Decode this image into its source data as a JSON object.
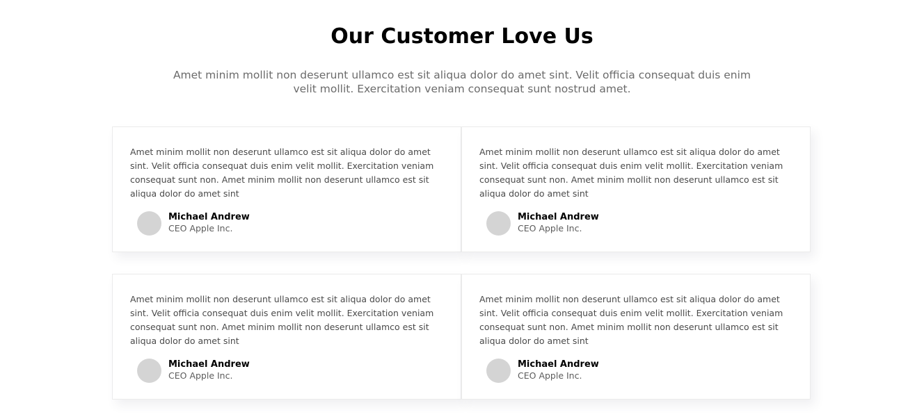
{
  "header": {
    "title": "Our Customer Love Us",
    "subtitle": "Amet minim mollit non deserunt ullamco est sit aliqua dolor do amet sint. Velit officia consequat duis enim velit mollit. Exercitation veniam consequat sunt nostrud amet."
  },
  "testimonials": [
    {
      "quote": "Amet minim mollit non deserunt ullamco est sit aliqua dolor do amet sint. Velit officia consequat duis enim velit mollit. Exercitation veniam consequat sunt non. Amet minim mollit non deserunt ullamco est sit aliqua dolor do amet sint",
      "name": "Michael Andrew",
      "role": "CEO Apple Inc."
    },
    {
      "quote": "Amet minim mollit non deserunt ullamco est sit aliqua dolor do amet sint. Velit officia consequat duis enim velit mollit. Exercitation veniam consequat sunt non. Amet minim mollit non deserunt ullamco est sit aliqua dolor do amet sint",
      "name": "Michael Andrew",
      "role": "CEO Apple Inc."
    },
    {
      "quote": "Amet minim mollit non deserunt ullamco est sit aliqua dolor do amet sint. Velit officia consequat duis enim velit mollit. Exercitation veniam consequat sunt non. Amet minim mollit non deserunt ullamco est sit aliqua dolor do amet sint",
      "name": "Michael Andrew",
      "role": "CEO Apple Inc."
    },
    {
      "quote": "Amet minim mollit non deserunt ullamco est sit aliqua dolor do amet sint. Velit officia consequat duis enim velit mollit. Exercitation veniam consequat sunt non. Amet minim mollit non deserunt ullamco est sit aliqua dolor do amet sint",
      "name": "Michael Andrew",
      "role": "CEO Apple Inc."
    }
  ],
  "colors": {
    "title": "#000000",
    "subtitle": "#6b6b6b",
    "card_border": "#ebebeb",
    "avatar_placeholder": "#d4d4d4"
  }
}
